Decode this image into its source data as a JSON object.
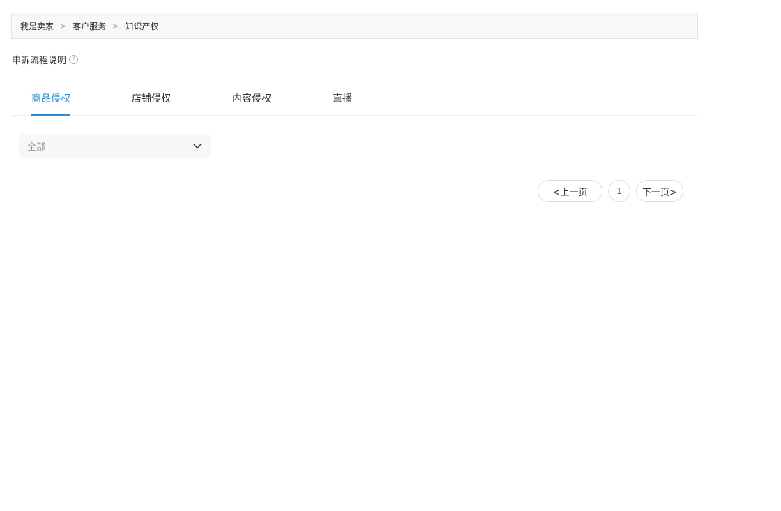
{
  "breadcrumb": {
    "items": [
      "我是卖家",
      "客户服务",
      "知识产权"
    ],
    "separator": ">"
  },
  "appeal": {
    "label": "申诉流程说明",
    "help_icon": "question-circle-icon",
    "help_glyph": "?"
  },
  "tabs": [
    {
      "label": "商品侵权",
      "active": true
    },
    {
      "label": "店铺侵权",
      "active": false
    },
    {
      "label": "内容侵权",
      "active": false
    },
    {
      "label": "直播",
      "active": false
    }
  ],
  "filter": {
    "value": "全部",
    "icon": "chevron-down-icon"
  },
  "pagination": {
    "prev_label": "<上一页",
    "current_page": "1",
    "next_label": "下一页>"
  },
  "colors": {
    "accent": "#2a8bd1",
    "breadcrumb_bg": "#f8f8f8",
    "select_bg": "#f6f7f9",
    "border": "#dddddd"
  }
}
